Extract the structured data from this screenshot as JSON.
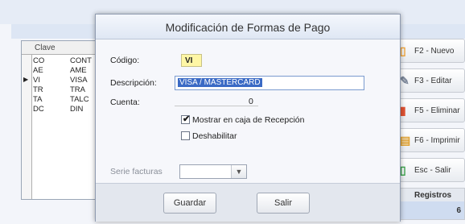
{
  "grid": {
    "header": "Clave",
    "rows": [
      {
        "code": "CO",
        "name": "CONT",
        "indicator": ""
      },
      {
        "code": "AE",
        "name": "AME",
        "indicator": ""
      },
      {
        "code": "VI",
        "name": "VISA",
        "indicator": "▶"
      },
      {
        "code": "TR",
        "name": "TRA",
        "indicator": ""
      },
      {
        "code": "TA",
        "name": "TALC",
        "indicator": ""
      },
      {
        "code": "DC",
        "name": "DIN",
        "indicator": ""
      }
    ]
  },
  "side_buttons": [
    {
      "label": "F2 - Nuevo",
      "icon": "new-doc-icon",
      "color": "#f0a43a"
    },
    {
      "label": "F3 - Editar",
      "icon": "edit-pencil-icon",
      "color": "#7a8598"
    },
    {
      "label": "F5 - Eliminar",
      "icon": "delete-icon",
      "color": "#e05333"
    },
    {
      "label": "F6 - Imprimir",
      "icon": "printer-icon",
      "color": "#e0a02e"
    },
    {
      "label": "Esc - Salir",
      "icon": "exit-icon",
      "color": "#3aa24a"
    }
  ],
  "registros": {
    "label": "Registros",
    "count": "6"
  },
  "dialog": {
    "title": "Modificación de Formas de Pago",
    "codigo_label": "Código:",
    "codigo_value": "VI",
    "descripcion_label": "Descripción:",
    "descripcion_value": "VISA / MASTERCARD",
    "cuenta_label": "Cuenta:",
    "cuenta_value": "0",
    "mostrar_label": "Mostrar en caja de Recepción",
    "mostrar_checked": true,
    "deshabilitar_label": "Deshabilitar",
    "deshabilitar_checked": false,
    "serie_label": "Serie facturas",
    "serie_value": "",
    "guardar_label": "Guardar",
    "salir_label": "Salir"
  }
}
